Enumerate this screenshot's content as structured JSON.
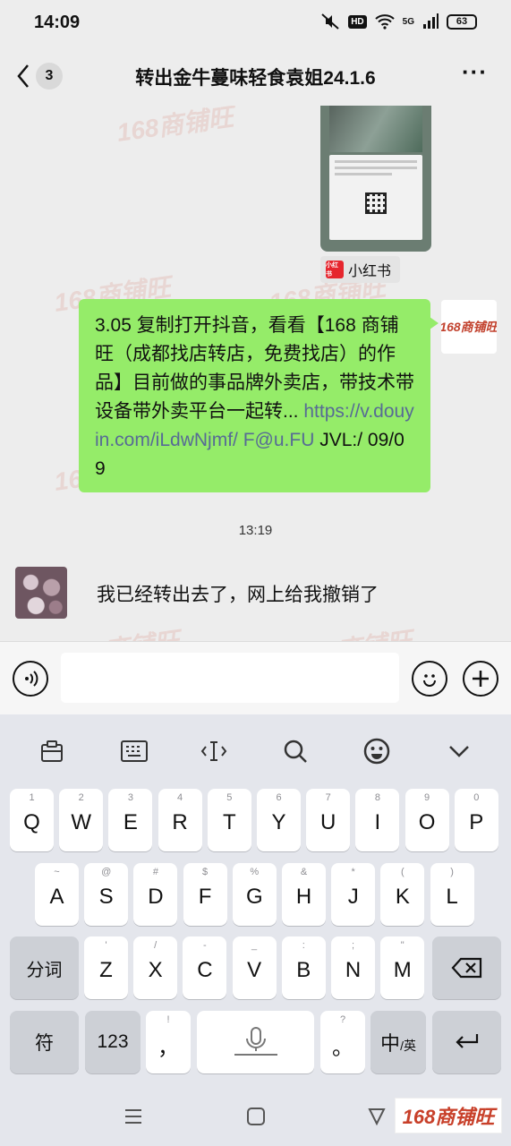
{
  "status_bar": {
    "time": "14:09",
    "network_label": "5G",
    "hd_label": "HD",
    "battery": "63"
  },
  "header": {
    "unread_count": "3",
    "title": "转出金牛蔓味轻食袁姐24.1.6",
    "more_label": "···"
  },
  "chat": {
    "shared_card": {
      "source_logo_text": "小红书",
      "source_label": "小红书"
    },
    "my_avatar_text": "168商铺旺",
    "outgoing_message": {
      "text": "3.05 复制打开抖音，看看【168 商铺旺（成都找店转店，免费找店）的作品】目前做的事品牌外卖店，带技术带设备带外卖平台一起转... ",
      "link": "https://v.douyin.com/iLdwNjmf/ F@u.FU",
      "suffix": " JVL:/ 09/09"
    },
    "time_divider": "13:19",
    "incoming_message": {
      "text": "我已经转出去了，网上给我撤销了"
    }
  },
  "input_bar": {
    "value": "",
    "placeholder": ""
  },
  "keyboard": {
    "row1": [
      {
        "key": "Q",
        "hint": "1"
      },
      {
        "key": "W",
        "hint": "2"
      },
      {
        "key": "E",
        "hint": "3"
      },
      {
        "key": "R",
        "hint": "4"
      },
      {
        "key": "T",
        "hint": "5"
      },
      {
        "key": "Y",
        "hint": "6"
      },
      {
        "key": "U",
        "hint": "7"
      },
      {
        "key": "I",
        "hint": "8"
      },
      {
        "key": "O",
        "hint": "9"
      },
      {
        "key": "P",
        "hint": "0"
      }
    ],
    "row2": [
      {
        "key": "A",
        "hint": "~"
      },
      {
        "key": "S",
        "hint": "@"
      },
      {
        "key": "D",
        "hint": "#"
      },
      {
        "key": "F",
        "hint": "$"
      },
      {
        "key": "G",
        "hint": "%"
      },
      {
        "key": "H",
        "hint": "&"
      },
      {
        "key": "J",
        "hint": "*"
      },
      {
        "key": "K",
        "hint": "("
      },
      {
        "key": "L",
        "hint": ")"
      }
    ],
    "row3": [
      {
        "key": "Z",
        "hint": "'"
      },
      {
        "key": "X",
        "hint": "/"
      },
      {
        "key": "C",
        "hint": "-"
      },
      {
        "key": "V",
        "hint": "_"
      },
      {
        "key": "B",
        "hint": ":"
      },
      {
        "key": "N",
        "hint": ";"
      },
      {
        "key": "M",
        "hint": "\""
      }
    ],
    "segment_label": "分词",
    "symbol_label": "符",
    "number_label": "123",
    "comma_label": "，",
    "comma_hint": "!",
    "period_label": "。",
    "period_hint": "?",
    "language_label_main": "中",
    "language_label_sub": "/英"
  },
  "bottom_logo": "168商铺旺",
  "watermark_text": "168商铺旺"
}
